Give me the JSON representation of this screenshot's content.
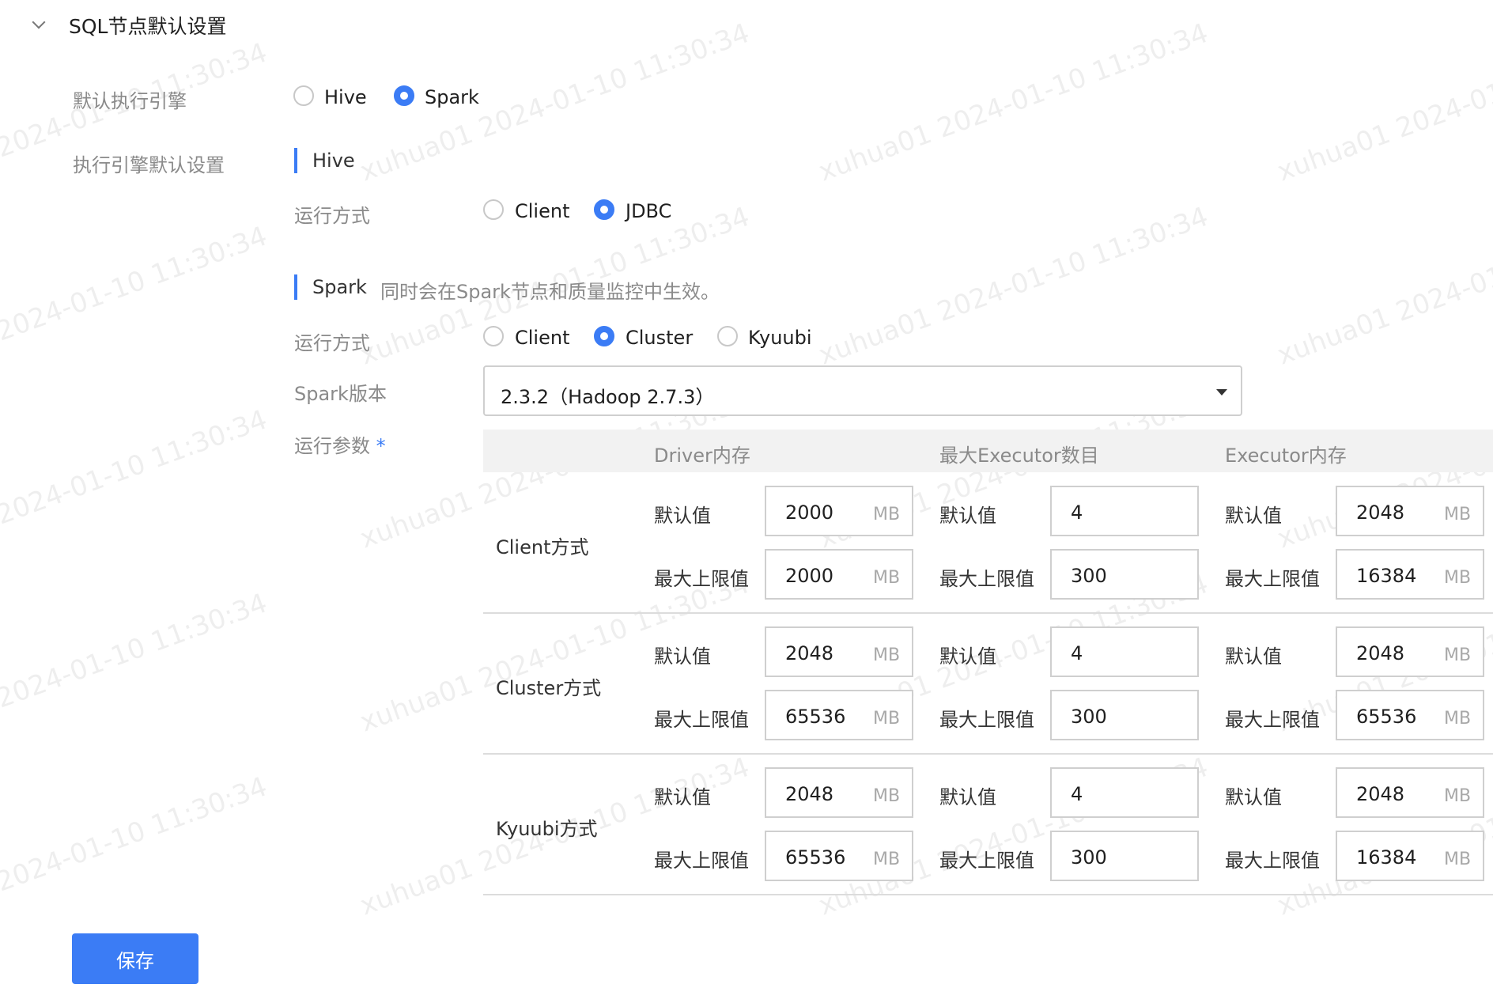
{
  "section": {
    "title": "SQL节点默认设置"
  },
  "engine": {
    "label": "默认执行引擎",
    "options": [
      "Hive",
      "Spark"
    ],
    "selected": "Spark"
  },
  "engine_defaults": {
    "label": "执行引擎默认设置"
  },
  "hive": {
    "title": "Hive",
    "run_mode_label": "运行方式",
    "run_modes": [
      "Client",
      "JDBC"
    ],
    "selected": "JDBC"
  },
  "spark": {
    "title": "Spark",
    "hint": "同时会在Spark节点和质量监控中生效。",
    "run_mode_label": "运行方式",
    "run_modes": [
      "Client",
      "Cluster",
      "Kyuubi"
    ],
    "selected": "Cluster",
    "version_label": "Spark版本",
    "version_value": "2.3.2（Hadoop 2.7.3）",
    "params_label": "运行参数",
    "required_mark": "*"
  },
  "params_table": {
    "columns": [
      "Driver内存",
      "最大Executor数目",
      "Executor内存"
    ],
    "default_label": "默认值",
    "max_label": "最大上限值",
    "unit": "MB",
    "rows": [
      {
        "label": "Client方式",
        "driver": {
          "default": "2000",
          "max": "2000"
        },
        "executors": {
          "default": "4",
          "max": "300"
        },
        "executor_mem": {
          "default": "2048",
          "max": "16384"
        }
      },
      {
        "label": "Cluster方式",
        "driver": {
          "default": "2048",
          "max": "65536"
        },
        "executors": {
          "default": "4",
          "max": "300"
        },
        "executor_mem": {
          "default": "2048",
          "max": "65536"
        }
      },
      {
        "label": "Kyuubi方式",
        "driver": {
          "default": "2048",
          "max": "65536"
        },
        "executors": {
          "default": "4",
          "max": "300"
        },
        "executor_mem": {
          "default": "2048",
          "max": "16384"
        }
      }
    ]
  },
  "save_button": "保存",
  "watermark": {
    "text_date": "2024-01-10 11:30:34",
    "text_full": "xuhua01 2024-01-10 11:30:34"
  },
  "colors": {
    "accent": "#3b7cf5",
    "border": "#cfcfcf",
    "muted": "#8a8a8a"
  }
}
